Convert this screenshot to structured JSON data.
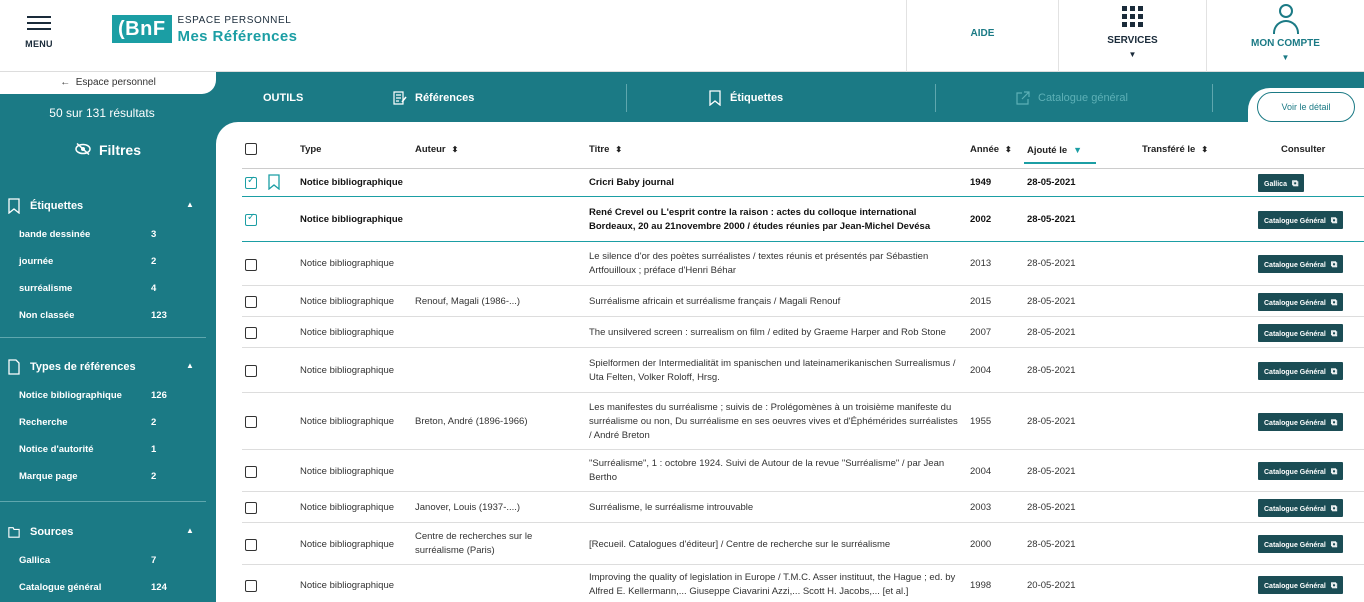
{
  "header": {
    "menu_label": "MENU",
    "logo": {
      "mark": "(BnF",
      "small": "ESPACE PERSONNEL",
      "big": "Mes Références"
    },
    "nav": {
      "aide": "AIDE",
      "services": "SERVICES",
      "account": "MON COMPTE"
    }
  },
  "sidebar": {
    "back_label": "Espace personnel",
    "result_count": "50 sur 131 résultats",
    "filters_title": "Filtres",
    "sections": [
      {
        "title": "Étiquettes",
        "items": [
          {
            "label": "bande dessinée",
            "count": "3"
          },
          {
            "label": "journée",
            "count": "2"
          },
          {
            "label": "surréalisme",
            "count": "4"
          },
          {
            "label": "Non classée",
            "count": "123"
          }
        ]
      },
      {
        "title": "Types de références",
        "items": [
          {
            "label": "Notice bibliographique",
            "count": "126"
          },
          {
            "label": "Recherche",
            "count": "2"
          },
          {
            "label": "Notice d'autorité",
            "count": "1"
          },
          {
            "label": "Marque page",
            "count": "2"
          }
        ]
      },
      {
        "title": "Sources",
        "items": [
          {
            "label": "Gallica",
            "count": "7"
          },
          {
            "label": "Catalogue général",
            "count": "124"
          }
        ]
      }
    ]
  },
  "toolbar": {
    "outils": "OUTILS",
    "references": "Références",
    "etiquettes": "Étiquettes",
    "catalogue": "Catalogue général",
    "detail_button": "Voir le détail"
  },
  "table": {
    "headers": {
      "type": "Type",
      "author": "Auteur",
      "title": "Titre",
      "year": "Année",
      "added": "Ajouté le",
      "transferred": "Transféré le",
      "consult": "Consulter"
    },
    "rows": [
      {
        "type": "Notice bibliographique",
        "author": "",
        "title": "Cricri Baby journal",
        "year": "1949",
        "added": "28-05-2021",
        "consult": "Gallica"
      },
      {
        "type": "Notice bibliographique",
        "author": "",
        "title": "René Crevel ou L'esprit contre la raison : actes du colloque international Bordeaux, 20 au 21novembre 2000 / études réunies par Jean-Michel Devésa",
        "year": "2002",
        "added": "28-05-2021",
        "consult": "Catalogue Général"
      },
      {
        "type": "Notice bibliographique",
        "author": "",
        "title": "Le silence d'or des poètes surréalistes / textes réunis et présentés par Sébastien Artfouilloux ; préface d'Henri Béhar",
        "year": "2013",
        "added": "28-05-2021",
        "consult": "Catalogue Général"
      },
      {
        "type": "Notice bibliographique",
        "author": "Renouf, Magali (1986-...)",
        "title": "Surréalisme africain et surréalisme français / Magali Renouf",
        "year": "2015",
        "added": "28-05-2021",
        "consult": "Catalogue Général"
      },
      {
        "type": "Notice bibliographique",
        "author": "",
        "title": "The unsilvered screen : surrealism on film / edited by Graeme Harper and Rob Stone",
        "year": "2007",
        "added": "28-05-2021",
        "consult": "Catalogue Général"
      },
      {
        "type": "Notice bibliographique",
        "author": "",
        "title": "Spielformen der Intermedialität im spanischen und lateinamerikanischen Surrealismus / Uta Felten, Volker Roloff, Hrsg.",
        "year": "2004",
        "added": "28-05-2021",
        "consult": "Catalogue Général"
      },
      {
        "type": "Notice bibliographique",
        "author": "Breton, André (1896-1966)",
        "title": "Les manifestes du surréalisme ; suivis de : Prolégomènes à un troisième manifeste du surréalisme ou non, Du surréalisme en ses oeuvres vives et d'Éphémérides surréalistes / André Breton",
        "year": "1955",
        "added": "28-05-2021",
        "consult": "Catalogue Général"
      },
      {
        "type": "Notice bibliographique",
        "author": "",
        "title": "\"Surréalisme\", 1 : octobre 1924. Suivi de Autour de la revue \"Surréalisme\" / par Jean Bertho",
        "year": "2004",
        "added": "28-05-2021",
        "consult": "Catalogue Général"
      },
      {
        "type": "Notice bibliographique",
        "author": "Janover, Louis (1937-....)",
        "title": "Surréalisme, le surréalisme introuvable",
        "year": "2003",
        "added": "28-05-2021",
        "consult": "Catalogue Général"
      },
      {
        "type": "Notice bibliographique",
        "author": "Centre de recherches sur le surréalisme (Paris)",
        "title": "[Recueil. Catalogues d'éditeur] / Centre de recherche sur le surréalisme",
        "year": "2000",
        "added": "28-05-2021",
        "consult": "Catalogue Général"
      },
      {
        "type": "Notice bibliographique",
        "author": "",
        "title": "Improving the quality of legislation in Europe / T.M.C. Asser instituut, the Hague ; ed. by Alfred E. Kellermann,... Giuseppe Ciavarini Azzi,... Scott H. Jacobs,... [et al.]",
        "year": "1998",
        "added": "20-05-2021",
        "consult": "Catalogue Général"
      }
    ]
  },
  "colors": {
    "teal": "#1b7a85",
    "accent": "#1b9ea4",
    "button": "#1b4d55"
  }
}
